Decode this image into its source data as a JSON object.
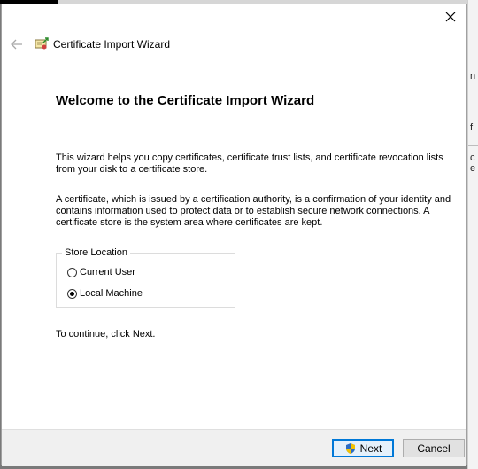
{
  "window": {
    "title": "Certificate Import Wizard",
    "close_label": "×"
  },
  "main": {
    "heading": "Welcome to the Certificate Import Wizard",
    "paragraph1": "This wizard helps you copy certificates, certificate trust lists, and certificate revocation lists from your disk to a certificate store.",
    "paragraph2": "A certificate, which is issued by a certification authority, is a confirmation of your identity and contains information used to protect data or to establish secure network connections. A certificate store is the system area where certificates are kept.",
    "store_location": {
      "label": "Store Location",
      "options": [
        {
          "label": "Current User",
          "selected": false
        },
        {
          "label": "Local Machine",
          "selected": true
        }
      ]
    },
    "continue_text": "To continue, click Next."
  },
  "footer": {
    "next_label": "Next",
    "cancel_label": "Cancel"
  },
  "colors": {
    "accent": "#0078d7",
    "footer_bg": "#f0f0f0",
    "dialog_bg": "#ffffff"
  },
  "icons": {
    "back": "arrow-left-icon",
    "wizard": "certificate-icon",
    "shield": "uac-shield-icon",
    "close": "close-icon"
  }
}
